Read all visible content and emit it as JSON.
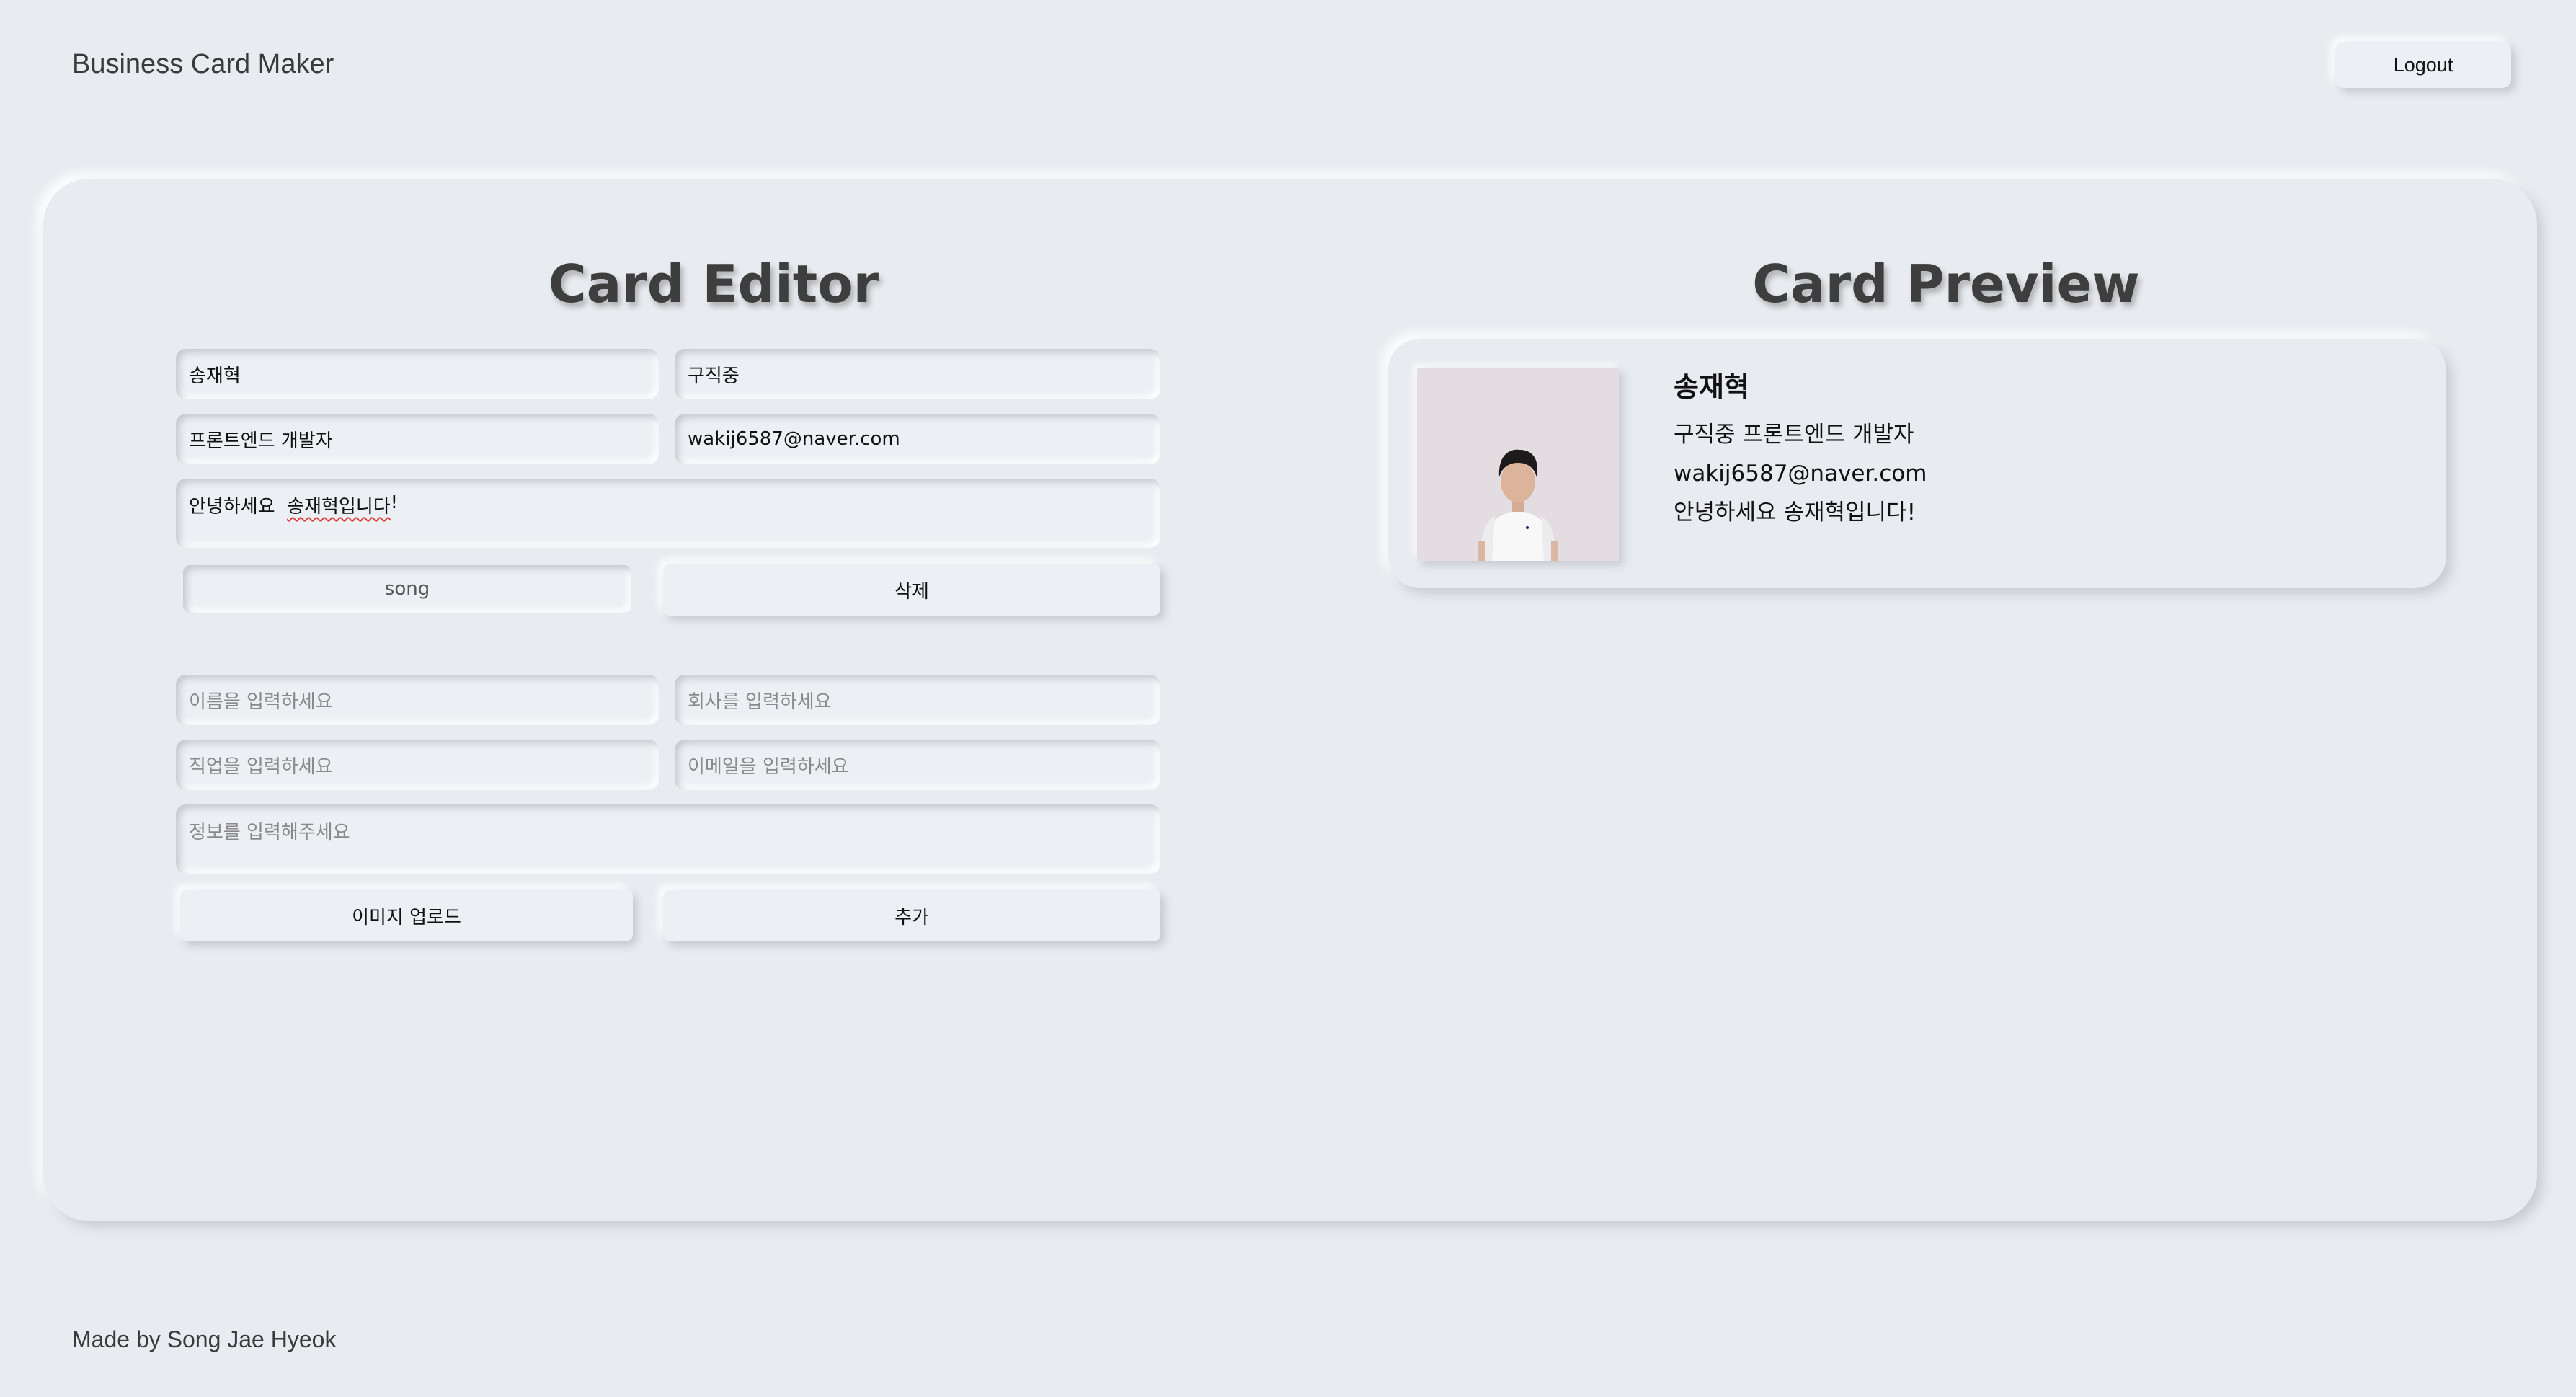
{
  "header": {
    "app_title": "Business Card Maker",
    "logout_label": "Logout"
  },
  "editor": {
    "title": "Card Editor",
    "card": {
      "name": "송재혁",
      "company": "구직중",
      "title": "프론트엔드 개발자",
      "email": "wakij6587@naver.com",
      "message_prefix": "안녕하세요  ",
      "message_underlined": "송재혁입니다",
      "message_suffix": "!",
      "theme": "song",
      "delete_label": "삭제"
    },
    "new_card": {
      "name_placeholder": "이름을 입력하세요",
      "company_placeholder": "회사를 입력하세요",
      "title_placeholder": "직업을 입력하세요",
      "email_placeholder": "이메일을 입력하세요",
      "message_placeholder": "정보를  입력해주세요",
      "upload_label": "이미지 업로드",
      "add_label": "추가"
    }
  },
  "preview": {
    "title": "Card Preview",
    "card": {
      "name": "송재혁",
      "company_title": "구직중 프론트엔드 개발자",
      "email": "wakij6587@naver.com",
      "message": "안녕하세요 송재혁입니다!"
    }
  },
  "footer": {
    "text": "Made by Song Jae Hyeok"
  }
}
